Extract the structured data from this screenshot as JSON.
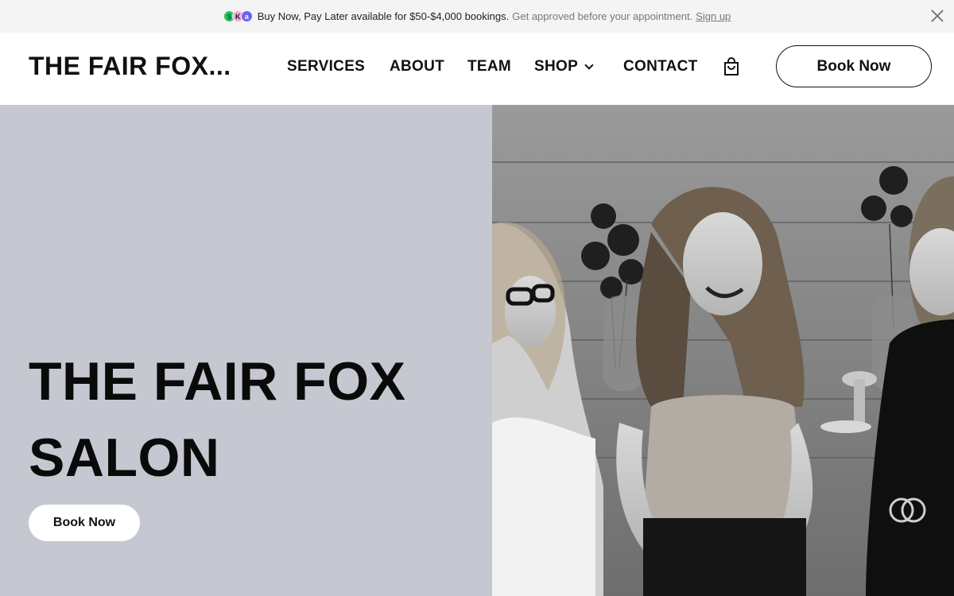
{
  "promo": {
    "main_text": "Buy Now, Pay Later available for $50-$4,000 bookings.",
    "sub_text": "Get approved before your appointment.",
    "link_text": "Sign up",
    "logos": [
      "$",
      "K",
      "a"
    ],
    "close_icon": "close-icon"
  },
  "header": {
    "logo": "THE FAIR FOX...",
    "nav": {
      "services": "SERVICES",
      "about": "ABOUT",
      "team": "TEAM",
      "shop": "SHOP",
      "contact": "CONTACT"
    },
    "cart_icon": "shopping-bag-icon",
    "book_label": "Book Now"
  },
  "hero": {
    "title_line1": "THE FAIR FOX",
    "title_line2": "SALON",
    "book_label": "Book Now",
    "photo_icon": "salon-team-photo"
  },
  "colors": {
    "hero_bg": "#c5c8d0",
    "promo_bg": "#f4f4f4",
    "text": "#111111"
  }
}
